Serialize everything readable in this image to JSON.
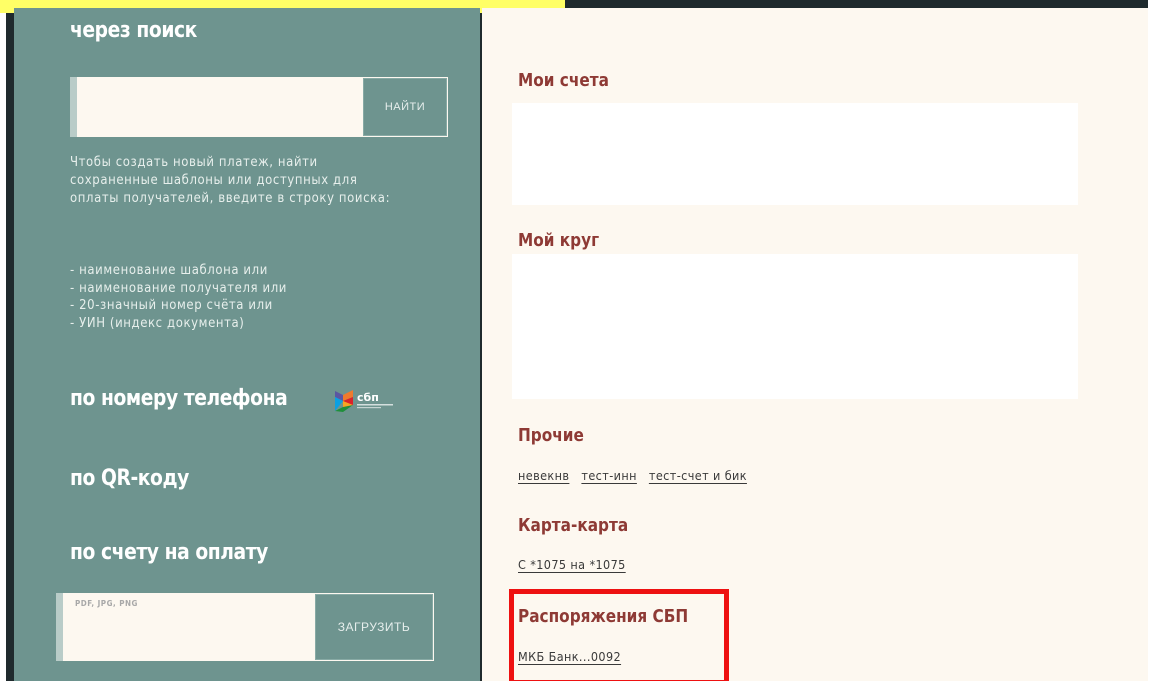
{
  "left_panel": {
    "search_section": {
      "title": "через поиск",
      "search_input_value": "",
      "search_button_label": "НАЙТИ",
      "help_text": "Чтобы создать новый платеж, найти сохраненные шаблоны или доступных для оплаты получателей, введите в строку поиска:",
      "help_items": [
        "- наименование шаблона или",
        "- наименование получателя или",
        "- 20-значный номер счёта или",
        "- УИН (индекс документа)"
      ]
    },
    "phone_section": {
      "title": "по номеру телефона",
      "logo_text": "сбп"
    },
    "qr_section": {
      "title": "по QR-коду"
    },
    "invoice_section": {
      "title": "по счету на оплату",
      "upload_placeholder": "PDF, JPG, PNG",
      "upload_button_label": "ЗАГРУЗИТЬ"
    }
  },
  "right_panel": {
    "my_accounts": {
      "title": "Мои счета"
    },
    "my_circle": {
      "title": "Мой круг"
    },
    "other": {
      "title": "Прочие",
      "links": [
        "невекнв",
        "тест-инн",
        "тест-счет и бик"
      ]
    },
    "card_to_card": {
      "title": "Карта-карта",
      "links": [
        "С *1075 на *1075"
      ]
    },
    "sbp_orders": {
      "title": "Распоряжения СБП",
      "links": [
        "МКБ Банк...0092"
      ]
    }
  },
  "colors": {
    "left_panel_bg": "#6e948f",
    "right_panel_bg": "#fdf8f0",
    "section_title": "#8e3a35",
    "highlight_border": "#ee1111",
    "top_highlight": "#ffff66"
  }
}
